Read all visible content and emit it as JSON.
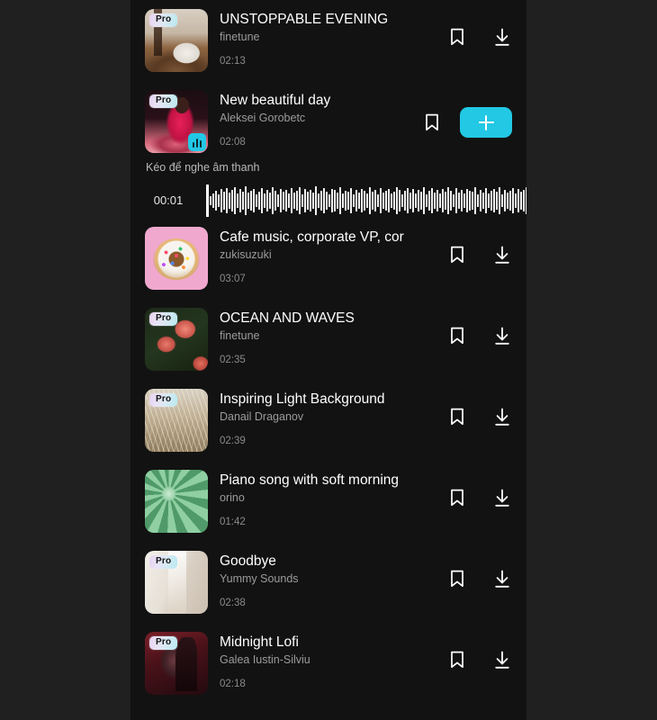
{
  "theme": {
    "outer_background": "#202020",
    "panel_background": "#121212",
    "accent": "#22c8e4",
    "title_color": "#ffffff",
    "subtitle_color": "#9b9b9b"
  },
  "player": {
    "hint": "Kéo để nghe âm thanh",
    "current_time": "00:01",
    "wave_heights": [
      36,
      10,
      16,
      22,
      14,
      26,
      20,
      28,
      18,
      24,
      30,
      16,
      26,
      20,
      32,
      18,
      22,
      26,
      14,
      20,
      28,
      16,
      24,
      18,
      30,
      22,
      14,
      26,
      20,
      24,
      16,
      28,
      18,
      22,
      30,
      14,
      26,
      20,
      24,
      18,
      32,
      16,
      22,
      28,
      20,
      14,
      26,
      24,
      18,
      30,
      16,
      22,
      20,
      28,
      14,
      24,
      18,
      26,
      22,
      16,
      30,
      20,
      24,
      14,
      28,
      18,
      22,
      26,
      16,
      20,
      30,
      24,
      14,
      22,
      28,
      18,
      26,
      16,
      24,
      20,
      30,
      14,
      22,
      28,
      18,
      24,
      16,
      26,
      20,
      30,
      22,
      14,
      28,
      18,
      24,
      16,
      26,
      22,
      20,
      30,
      14,
      24,
      18,
      28,
      16,
      22,
      26,
      20,
      30,
      14,
      24,
      18,
      22,
      28,
      16,
      26,
      20,
      24,
      30,
      18,
      14,
      22,
      26,
      20,
      28,
      16,
      24,
      18,
      30,
      22,
      14,
      26,
      20,
      24,
      16,
      28,
      18,
      22,
      30,
      14,
      26,
      20,
      24,
      18,
      22,
      16,
      28,
      20,
      26,
      14,
      24,
      18,
      30,
      22,
      16,
      26,
      20,
      28,
      14,
      24,
      18,
      22
    ]
  },
  "icons": {
    "bookmark": "bookmark-icon",
    "download": "download-icon",
    "add": "plus-icon",
    "equalizer": "equalizer-icon"
  },
  "tracks": [
    {
      "title": "UNSTOPPABLE EVENING",
      "artist": "finetune",
      "duration": "02:13",
      "pro": true,
      "pro_label": "Pro",
      "art": "art-coffee",
      "action": "download",
      "playing": false
    },
    {
      "title": "New beautiful day",
      "artist": "Aleksei Gorobetc",
      "duration": "02:08",
      "pro": true,
      "pro_label": "Pro",
      "art": "art-dancer",
      "action": "add",
      "playing": true
    },
    {
      "title": "Cafe music, corporate VP, cor",
      "artist": "zukisuzuki",
      "duration": "03:07",
      "pro": false,
      "pro_label": "",
      "art": "art-donut",
      "action": "download",
      "playing": false
    },
    {
      "title": "OCEAN AND WAVES",
      "artist": "finetune",
      "duration": "02:35",
      "pro": true,
      "pro_label": "Pro",
      "art": "art-roses",
      "action": "download",
      "playing": false
    },
    {
      "title": "Inspiring Light Background",
      "artist": "Danail Draganov",
      "duration": "02:39",
      "pro": true,
      "pro_label": "Pro",
      "art": "art-grass",
      "action": "download",
      "playing": false
    },
    {
      "title": "Piano song with soft morning",
      "artist": "orino",
      "duration": "01:42",
      "pro": false,
      "pro_label": "",
      "art": "art-flower",
      "action": "download",
      "playing": false
    },
    {
      "title": "Goodbye",
      "artist": "Yummy Sounds",
      "duration": "02:38",
      "pro": true,
      "pro_label": "Pro",
      "art": "art-veil",
      "action": "download",
      "playing": false
    },
    {
      "title": "Midnight Lofi",
      "artist": "Galea Iustin-Silviu",
      "duration": "02:18",
      "pro": true,
      "pro_label": "Pro",
      "art": "art-night",
      "action": "download",
      "playing": false
    }
  ]
}
